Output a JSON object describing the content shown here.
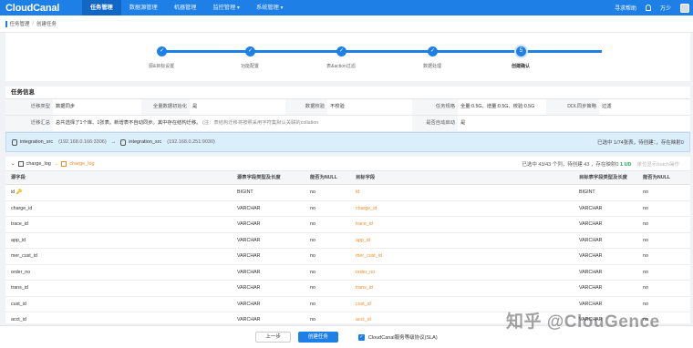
{
  "nav": {
    "logo": "CloudCanal",
    "items": [
      "任务管理",
      "数据源管理",
      "机器管理",
      "监控管理",
      "系统管理"
    ],
    "help": "寻求帮助",
    "user": "万少"
  },
  "breadcrumb": [
    "任务管理",
    "创建任务"
  ],
  "steps": [
    "源&目标设置",
    "功能配置",
    "表&action过滤",
    "数据处理",
    "创建确认"
  ],
  "step_current_number": "5",
  "section_title": "任务信息",
  "info": {
    "r1": [
      [
        "迁移类型",
        "数据同步"
      ],
      [
        "全量数据初始化",
        "是"
      ],
      [
        "数据校验",
        "不校验"
      ],
      [
        "任务规格",
        "全量:0.5G、增量:0.5G、校验:0.5G"
      ],
      [
        "DDL同步策略",
        "过滤"
      ]
    ],
    "r2_label": "迁移汇总",
    "r2_value": "总共选择了1个库、1张表。新增表不自动同步。其中存在结构迁移。",
    "r2_hint": "(注：表结构迁移将按照采用字符集默认关联的collation",
    "r2_label2": "是否自动启动",
    "r2_value2": "是"
  },
  "conn": {
    "src": "integration_src",
    "src_ip": "(192.168.0.166:3306)",
    "dst": "integration_src",
    "dst_ip": "(192.168.0.251:9030)",
    "status": "已选中 1/74张表，待创建：，存在映射0"
  },
  "table": {
    "src_table": "charge_log",
    "dst_table": "charge_log",
    "stat": "已选中 43/43 个列，待创建 43 ，存在映射0",
    "ok": "1 UD",
    "disabled_action": "单位显示batch操作",
    "headers": [
      "源字段",
      "源表字段类型及长度",
      "能否为NULL",
      "目标字段",
      "目标表字段类型及长度",
      "能否为NULL"
    ],
    "rows": [
      [
        "id 🔑",
        "BIGINT",
        "no",
        "id",
        "BIGINT",
        "no"
      ],
      [
        "charge_id",
        "VARCHAR",
        "no",
        "charge_id",
        "VARCHAR",
        "no"
      ],
      [
        "trace_id",
        "VARCHAR",
        "no",
        "trace_id",
        "VARCHAR",
        "no"
      ],
      [
        "app_id",
        "VARCHAR",
        "no",
        "app_id",
        "VARCHAR",
        "no"
      ],
      [
        "mer_cust_id",
        "VARCHAR",
        "no",
        "mer_cust_id",
        "VARCHAR",
        "no"
      ],
      [
        "order_no",
        "VARCHAR",
        "no",
        "order_no",
        "VARCHAR",
        "no"
      ],
      [
        "trans_id",
        "VARCHAR",
        "no",
        "trans_id",
        "VARCHAR",
        "no"
      ],
      [
        "cust_id",
        "VARCHAR",
        "no",
        "cust_id",
        "VARCHAR",
        "no"
      ],
      [
        "acct_id",
        "VARCHAR",
        "no",
        "acct_id",
        "VARCHAR",
        "no"
      ]
    ]
  },
  "footer": {
    "prev": "上一步",
    "create": "创建任务",
    "agree": "CloudCanal服务等级协议(SLA)"
  },
  "watermark": "知乎 @ClouGence",
  "colors": {
    "accent": "#1e80e6",
    "orange": "#f08c28"
  }
}
